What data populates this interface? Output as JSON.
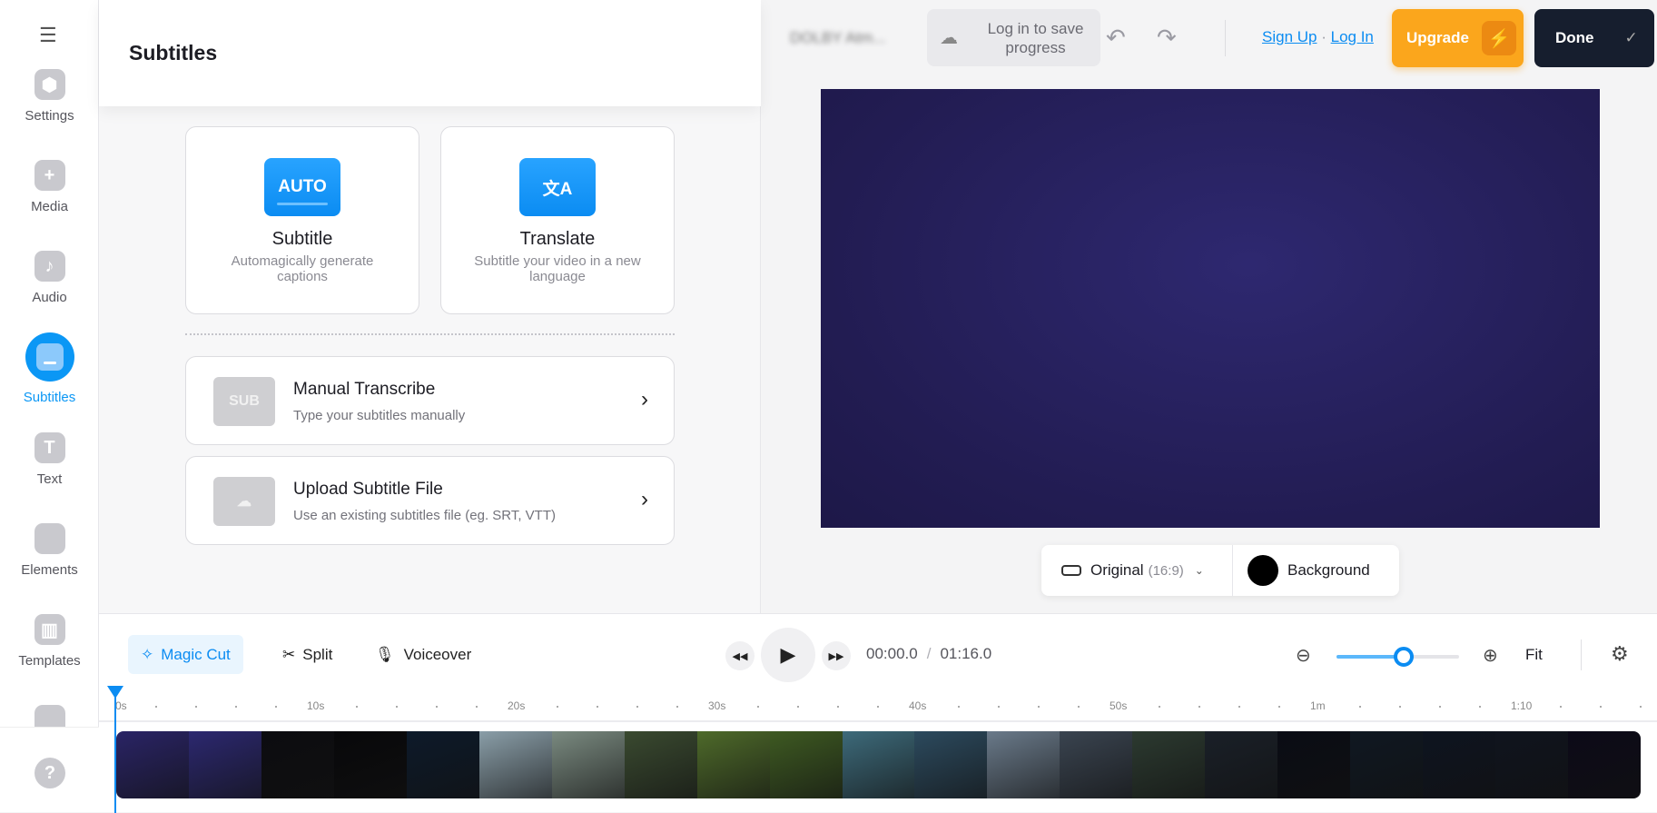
{
  "sidebar": {
    "items": [
      {
        "label": "Settings",
        "icon": "⬢"
      },
      {
        "label": "Media",
        "icon": "+"
      },
      {
        "label": "Audio",
        "icon": "♪"
      },
      {
        "label": "Subtitles",
        "icon": ""
      },
      {
        "label": "Text",
        "icon": "T"
      },
      {
        "label": "Elements",
        "icon": ""
      },
      {
        "label": "Templates",
        "icon": "▥"
      }
    ],
    "help": "?"
  },
  "panel": {
    "title": "Subtitles",
    "cards": [
      {
        "icon": "AUTO",
        "title": "Subtitle",
        "desc": "Automagically generate captions"
      },
      {
        "icon": "文A",
        "title": "Translate",
        "desc": "Subtitle your video in a new language"
      }
    ],
    "rows": [
      {
        "thumb": "SUB",
        "title": "Manual Transcribe",
        "desc": "Type your subtitles manually"
      },
      {
        "thumb": "☁",
        "title": "Upload Subtitle File",
        "desc": "Use an existing subtitles file (eg. SRT, VTT)"
      }
    ]
  },
  "topbar": {
    "project_name": "DOLBY Atm...",
    "save_hint": "Log in to save progress",
    "sign_up": "Sign Up",
    "sep": "·",
    "log_in": "Log In",
    "upgrade": "Upgrade",
    "done": "Done"
  },
  "canvas": {
    "bg_color": "#241d55",
    "aspect_label": "Original",
    "aspect_ratio": "(16:9)",
    "background_label": "Background"
  },
  "toolbar": {
    "magic_cut": "Magic Cut",
    "split": "Split",
    "voiceover": "Voiceover",
    "current_time": "00:00.0",
    "duration": "01:16.0",
    "fit": "Fit",
    "zoom_level": 0.55
  },
  "ruler": [
    "0s",
    "10s",
    "20s",
    "30s",
    "40s",
    "50s",
    "1m",
    "1:10"
  ],
  "thumbnail_colors": [
    "#2a2466",
    "#2c2870",
    "#0c0c10",
    "#08080a",
    "#0d1a2a",
    "#8a9ea8",
    "#7a8a80",
    "#3a4a30",
    "#4e6a2a",
    "#3e5a22",
    "#3d6a7a",
    "#2c4a5e",
    "#6a7a8a",
    "#3a4450",
    "#2c3a30",
    "#1a2028",
    "#0a0c14",
    "#101822",
    "#0e1420",
    "#10141e",
    "#0c0a18"
  ]
}
